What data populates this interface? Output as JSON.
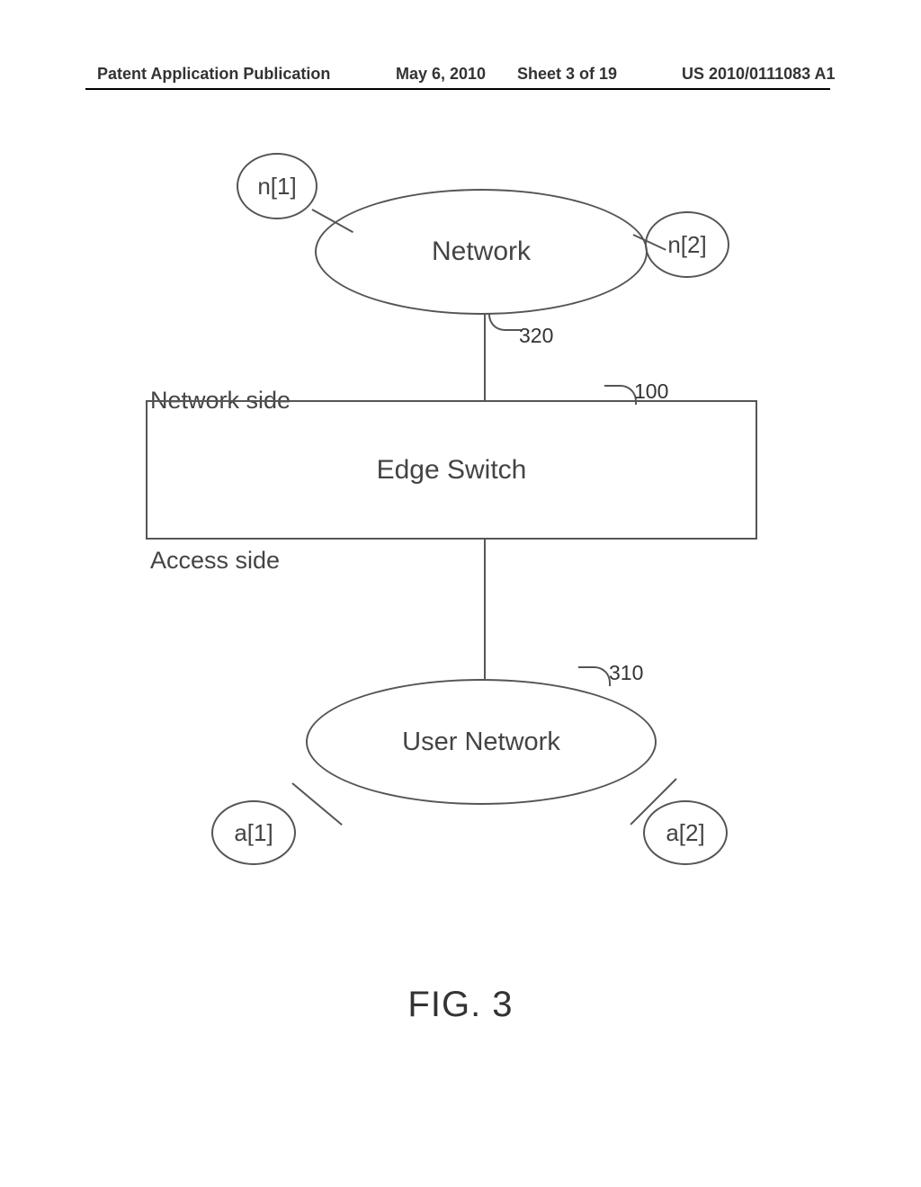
{
  "header": {
    "left": "Patent Application Publication",
    "date": "May 6, 2010",
    "sheet": "Sheet 3 of 19",
    "pubno": "US 2010/0111083 A1"
  },
  "diagram": {
    "network_label": "Network",
    "node_n1": "n[1]",
    "node_n2": "n[2]",
    "ref_network": "320",
    "network_side_label": "Network side",
    "ref_switch": "100",
    "edge_switch_label": "Edge Switch",
    "access_side_label": "Access side",
    "ref_user": "310",
    "user_network_label": "User Network",
    "node_a1": "a[1]",
    "node_a2": "a[2]"
  },
  "figure_caption": "FIG. 3"
}
